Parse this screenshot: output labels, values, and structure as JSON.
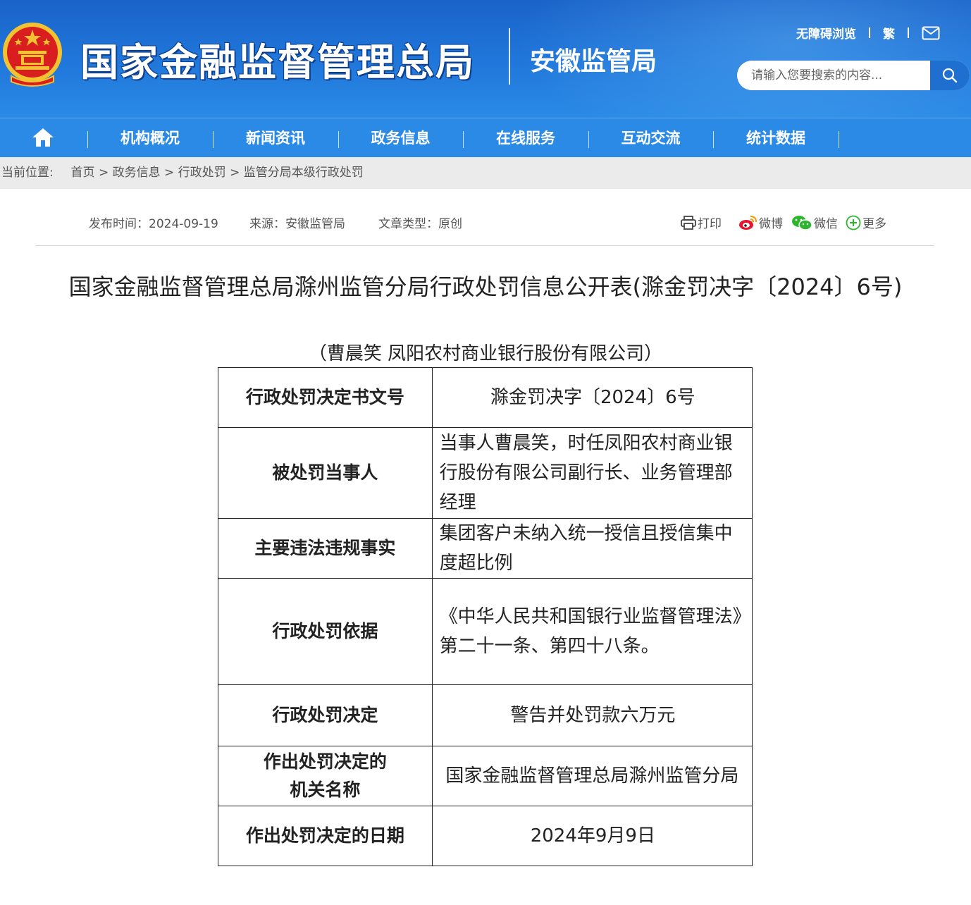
{
  "header": {
    "site_title": "国家金融监督管理总局",
    "sub_title": "安徽监管局",
    "accessibility_link": "无障碍浏览",
    "traditional_link": "繁",
    "search_placeholder": "请输入您要搜索的内容..."
  },
  "nav": {
    "items": [
      "机构概况",
      "新闻资讯",
      "政务信息",
      "在线服务",
      "互动交流",
      "统计数据"
    ]
  },
  "breadcrumb": {
    "label": "当前位置:",
    "items": [
      "首页",
      "政务信息",
      "行政处罚",
      "监管分局本级行政处罚"
    ],
    "separator": ">"
  },
  "meta": {
    "publish": "发布时间：2024-09-19",
    "source": "来源：安徽监管局",
    "type": "文章类型：原创"
  },
  "share": {
    "print": "打印",
    "weibo": "微博",
    "wechat": "微信",
    "more": "更多"
  },
  "article": {
    "title": "国家金融监督管理总局滁州监管分局行政处罚信息公开表(滁金罚决字〔2024〕6号)",
    "subject": "（曹晨笑 凤阳农村商业银行股份有限公司）",
    "rows": [
      {
        "key": "行政处罚决定书文号",
        "value": "滁金罚决字〔2024〕6号"
      },
      {
        "key": "被处罚当事人",
        "value": "当事人曹晨笑，时任凤阳农村商业银行股份有限公司副行长、业务管理部经理"
      },
      {
        "key": "主要违法违规事实",
        "value": "集团客户未纳入统一授信且授信集中度超比例"
      },
      {
        "key": "行政处罚依据",
        "value": "《中华人民共和国银行业监督管理法》第二十一条、第四十八条。"
      },
      {
        "key": "行政处罚决定",
        "value": "警告并处罚款六万元"
      },
      {
        "key": "作出处罚决定的机关名称",
        "value": "国家金融监督管理总局滁州监管分局"
      },
      {
        "key": "作出处罚决定的日期",
        "value": "2024年9月9日"
      }
    ]
  },
  "colors": {
    "header_blue": "#1f74d8",
    "nav_blue": "#2a8ae6",
    "emblem_red": "#d81e1e",
    "emblem_gold": "#f2c230"
  }
}
